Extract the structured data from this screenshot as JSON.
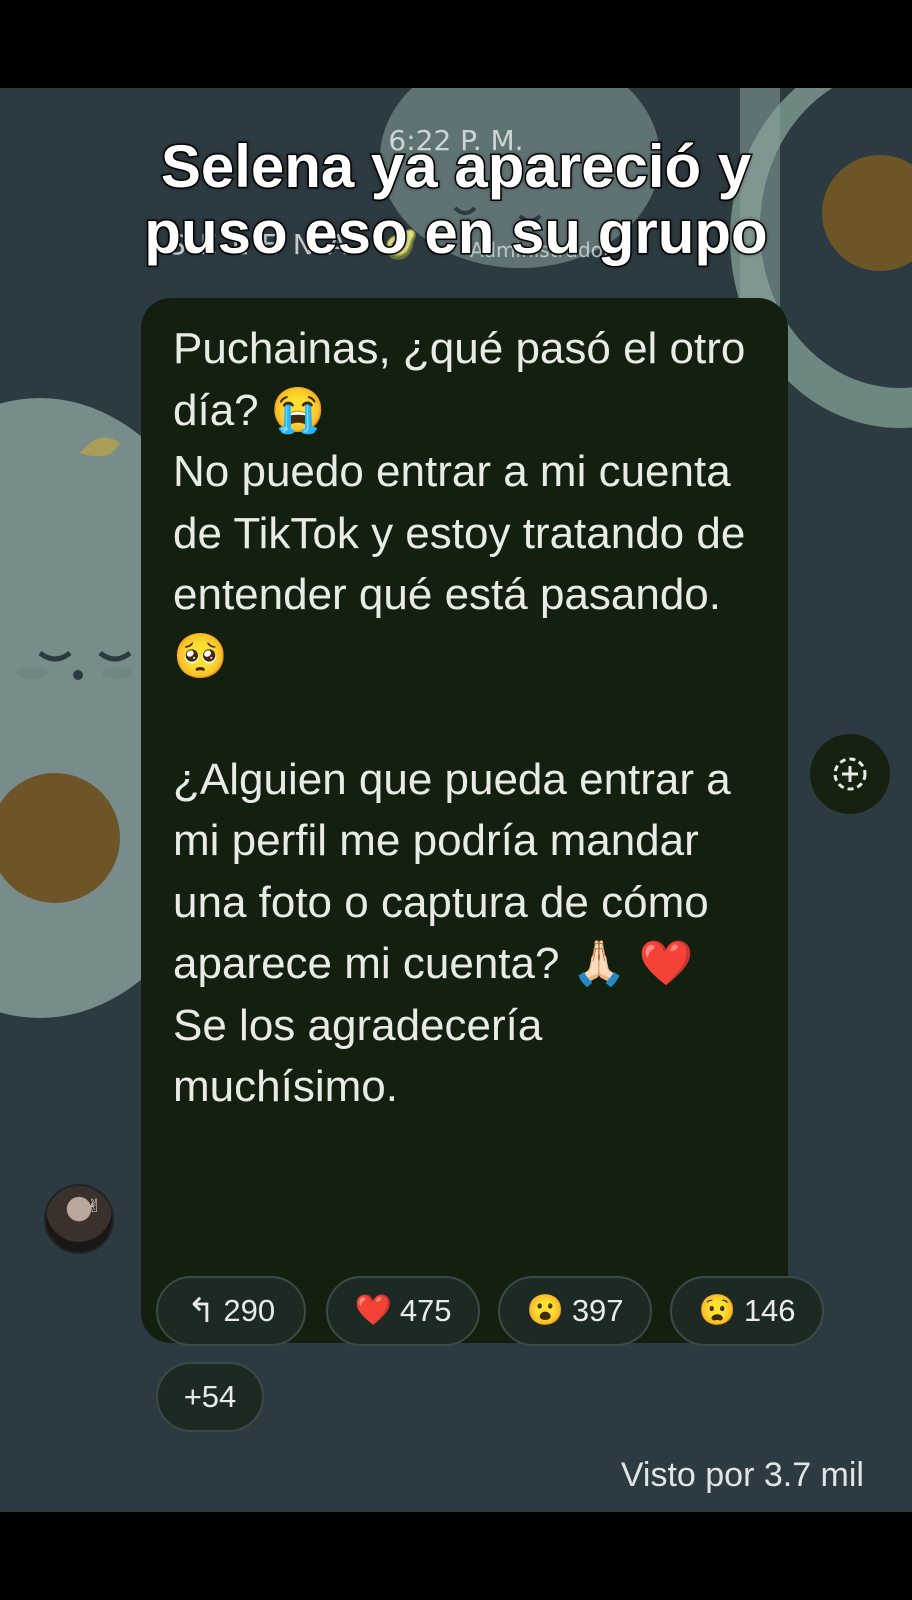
{
  "overlay": {
    "caption_line1": "Selena ya apareció y",
    "caption_line2": "puso eso en su grupo"
  },
  "header": {
    "time": "6:22 P. M.",
    "sender": "SELENA 🥑",
    "role": "Administrador"
  },
  "message": {
    "text": "Puchainas, ¿qué pasó el otro día? 😭\nNo puedo entrar a mi cuenta de TikTok y estoy tratando de entender qué está pasando. 🥺\n\n¿Alguien que pueda entrar a mi perfil me podría mandar una foto o captura de cómo aparece mi cuenta? 🙏🏻 ❤️\nSe los agradecería muchísimo."
  },
  "avatar": {
    "icon": "avatar-photo"
  },
  "share": {
    "icon": "share-plus-icon"
  },
  "reactions": [
    {
      "icon": "reply-arrow-icon",
      "emoji": "↰",
      "count": "290"
    },
    {
      "icon": "heart-icon",
      "emoji": "❤️",
      "count": "475"
    },
    {
      "icon": "surprised-face-icon",
      "emoji": "😮",
      "count": "397"
    },
    {
      "icon": "worried-face-icon",
      "emoji": "😧",
      "count": "146"
    },
    {
      "icon": "more-reactions",
      "emoji": "",
      "count": "+54"
    }
  ],
  "footer": {
    "seen_by": "Visto por 3.7 mil"
  },
  "colors": {
    "chat_background": "#2c3a41",
    "bubble": "#14200f",
    "avocado_light": "#8ca29e",
    "avocado_seed": "#6d5527"
  }
}
